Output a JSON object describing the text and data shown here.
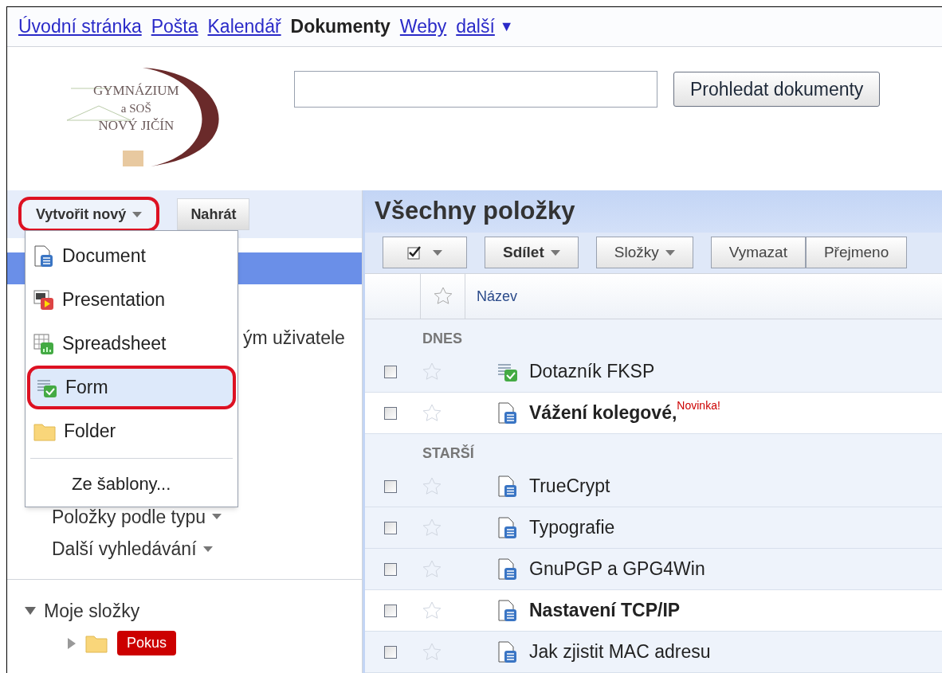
{
  "nav": [
    {
      "label": "Úvodní stránka",
      "selected": false
    },
    {
      "label": "Pošta",
      "selected": false
    },
    {
      "label": "Kalendář",
      "selected": false
    },
    {
      "label": "Dokumenty",
      "selected": true
    },
    {
      "label": "Weby",
      "selected": false
    },
    {
      "label": "další",
      "selected": false,
      "caret": "▼"
    }
  ],
  "logo": {
    "lines": [
      "GYMNÁZIUM",
      "a SOŠ",
      "NOVÝ JIČÍN"
    ]
  },
  "search": {
    "button": "Prohledat dokumenty"
  },
  "create_button": {
    "label": "Vytvořit nový",
    "highlighted": true
  },
  "upload_button": {
    "label": "Nahrát"
  },
  "new_menu": {
    "items": [
      {
        "kind": "document",
        "label": "Document",
        "highlighted": false
      },
      {
        "kind": "presentation",
        "label": "Presentation",
        "highlighted": false
      },
      {
        "kind": "spreadsheet",
        "label": "Spreadsheet",
        "highlighted": false
      },
      {
        "kind": "form",
        "label": "Form",
        "highlighted": true
      },
      {
        "kind": "folder",
        "label": "Folder",
        "highlighted": false
      }
    ],
    "template": "Ze šablony..."
  },
  "sidebar": {
    "partial_text": "ým uživatele",
    "filters": [
      "Položky podle typu",
      "Další vyhledávání"
    ],
    "folders": {
      "label": "Moje složky",
      "expanded": true,
      "children": [
        {
          "label": "Pokus",
          "color": "#cc0000",
          "expanded": false
        }
      ]
    }
  },
  "main": {
    "title": "Všechny položky",
    "toolbar": [
      {
        "label": "Sdílet",
        "dropdown": true,
        "bold": true
      },
      {
        "label": "Složky",
        "dropdown": true,
        "bold": false
      },
      {
        "label": "Vymazat",
        "dropdown": false,
        "bold": false
      },
      {
        "label": "Přejmeno",
        "dropdown": false,
        "bold": false
      }
    ],
    "column": "Název",
    "groups": [
      {
        "label": "DNES",
        "rows": [
          {
            "kind": "form",
            "name": "Dotazník FKSP",
            "bold": false,
            "checked": false,
            "starred": false
          },
          {
            "kind": "document",
            "name": "Vážení kolegové,",
            "bold": true,
            "checked": false,
            "starred": false,
            "badge": "Novinka!"
          }
        ]
      },
      {
        "label": "STARŠÍ",
        "rows": [
          {
            "kind": "document",
            "name": "TrueCrypt",
            "bold": false,
            "checked": false,
            "starred": false
          },
          {
            "kind": "document",
            "name": "Typografie",
            "bold": false,
            "checked": false,
            "starred": false
          },
          {
            "kind": "document",
            "name": "GnuPGP a GPG4Win",
            "bold": false,
            "checked": false,
            "starred": false
          },
          {
            "kind": "document",
            "name": "Nastavení TCP/IP",
            "bold": true,
            "checked": false,
            "starred": false
          },
          {
            "kind": "document",
            "name": "Jak zjistit MAC adresu",
            "bold": false,
            "checked": false,
            "starred": false
          }
        ]
      }
    ]
  }
}
